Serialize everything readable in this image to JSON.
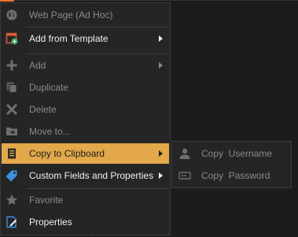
{
  "context_menu": {
    "items": [
      {
        "label": "Web Page (Ad Hoc)",
        "icon": "globe-icon",
        "state": "disabled"
      },
      {
        "label": "Add from Template",
        "icon": "add-template-icon",
        "state": "enabled",
        "submenu": true
      },
      {
        "label": "Add",
        "icon": "plus-icon",
        "state": "disabled",
        "submenu": true
      },
      {
        "label": "Duplicate",
        "icon": "duplicate-icon",
        "state": "disabled"
      },
      {
        "label": "Delete",
        "icon": "delete-x-icon",
        "state": "disabled"
      },
      {
        "label": "Move to...",
        "icon": "move-folder-icon",
        "state": "disabled"
      },
      {
        "label": "Copy to Clipboard",
        "icon": "clipboard-icon",
        "state": "highlighted",
        "submenu": true
      },
      {
        "label": "Custom Fields and Properties",
        "icon": "tag-icon",
        "state": "enabled",
        "submenu": true
      },
      {
        "label": "Favorite",
        "icon": "star-icon",
        "state": "disabled"
      },
      {
        "label": "Properties",
        "icon": "properties-icon",
        "state": "enabled"
      }
    ]
  },
  "submenu": {
    "items": [
      {
        "label": "Copy  Username",
        "icon": "user-icon",
        "state": "disabled"
      },
      {
        "label": "Copy  Password",
        "icon": "password-icon",
        "state": "disabled"
      }
    ]
  },
  "colors": {
    "menu_bg": "#252526",
    "highlight": "#e2a849",
    "text_enabled": "#f1f1f1",
    "text_disabled": "#8a8a8a",
    "accent_orange": "#e8762b"
  }
}
